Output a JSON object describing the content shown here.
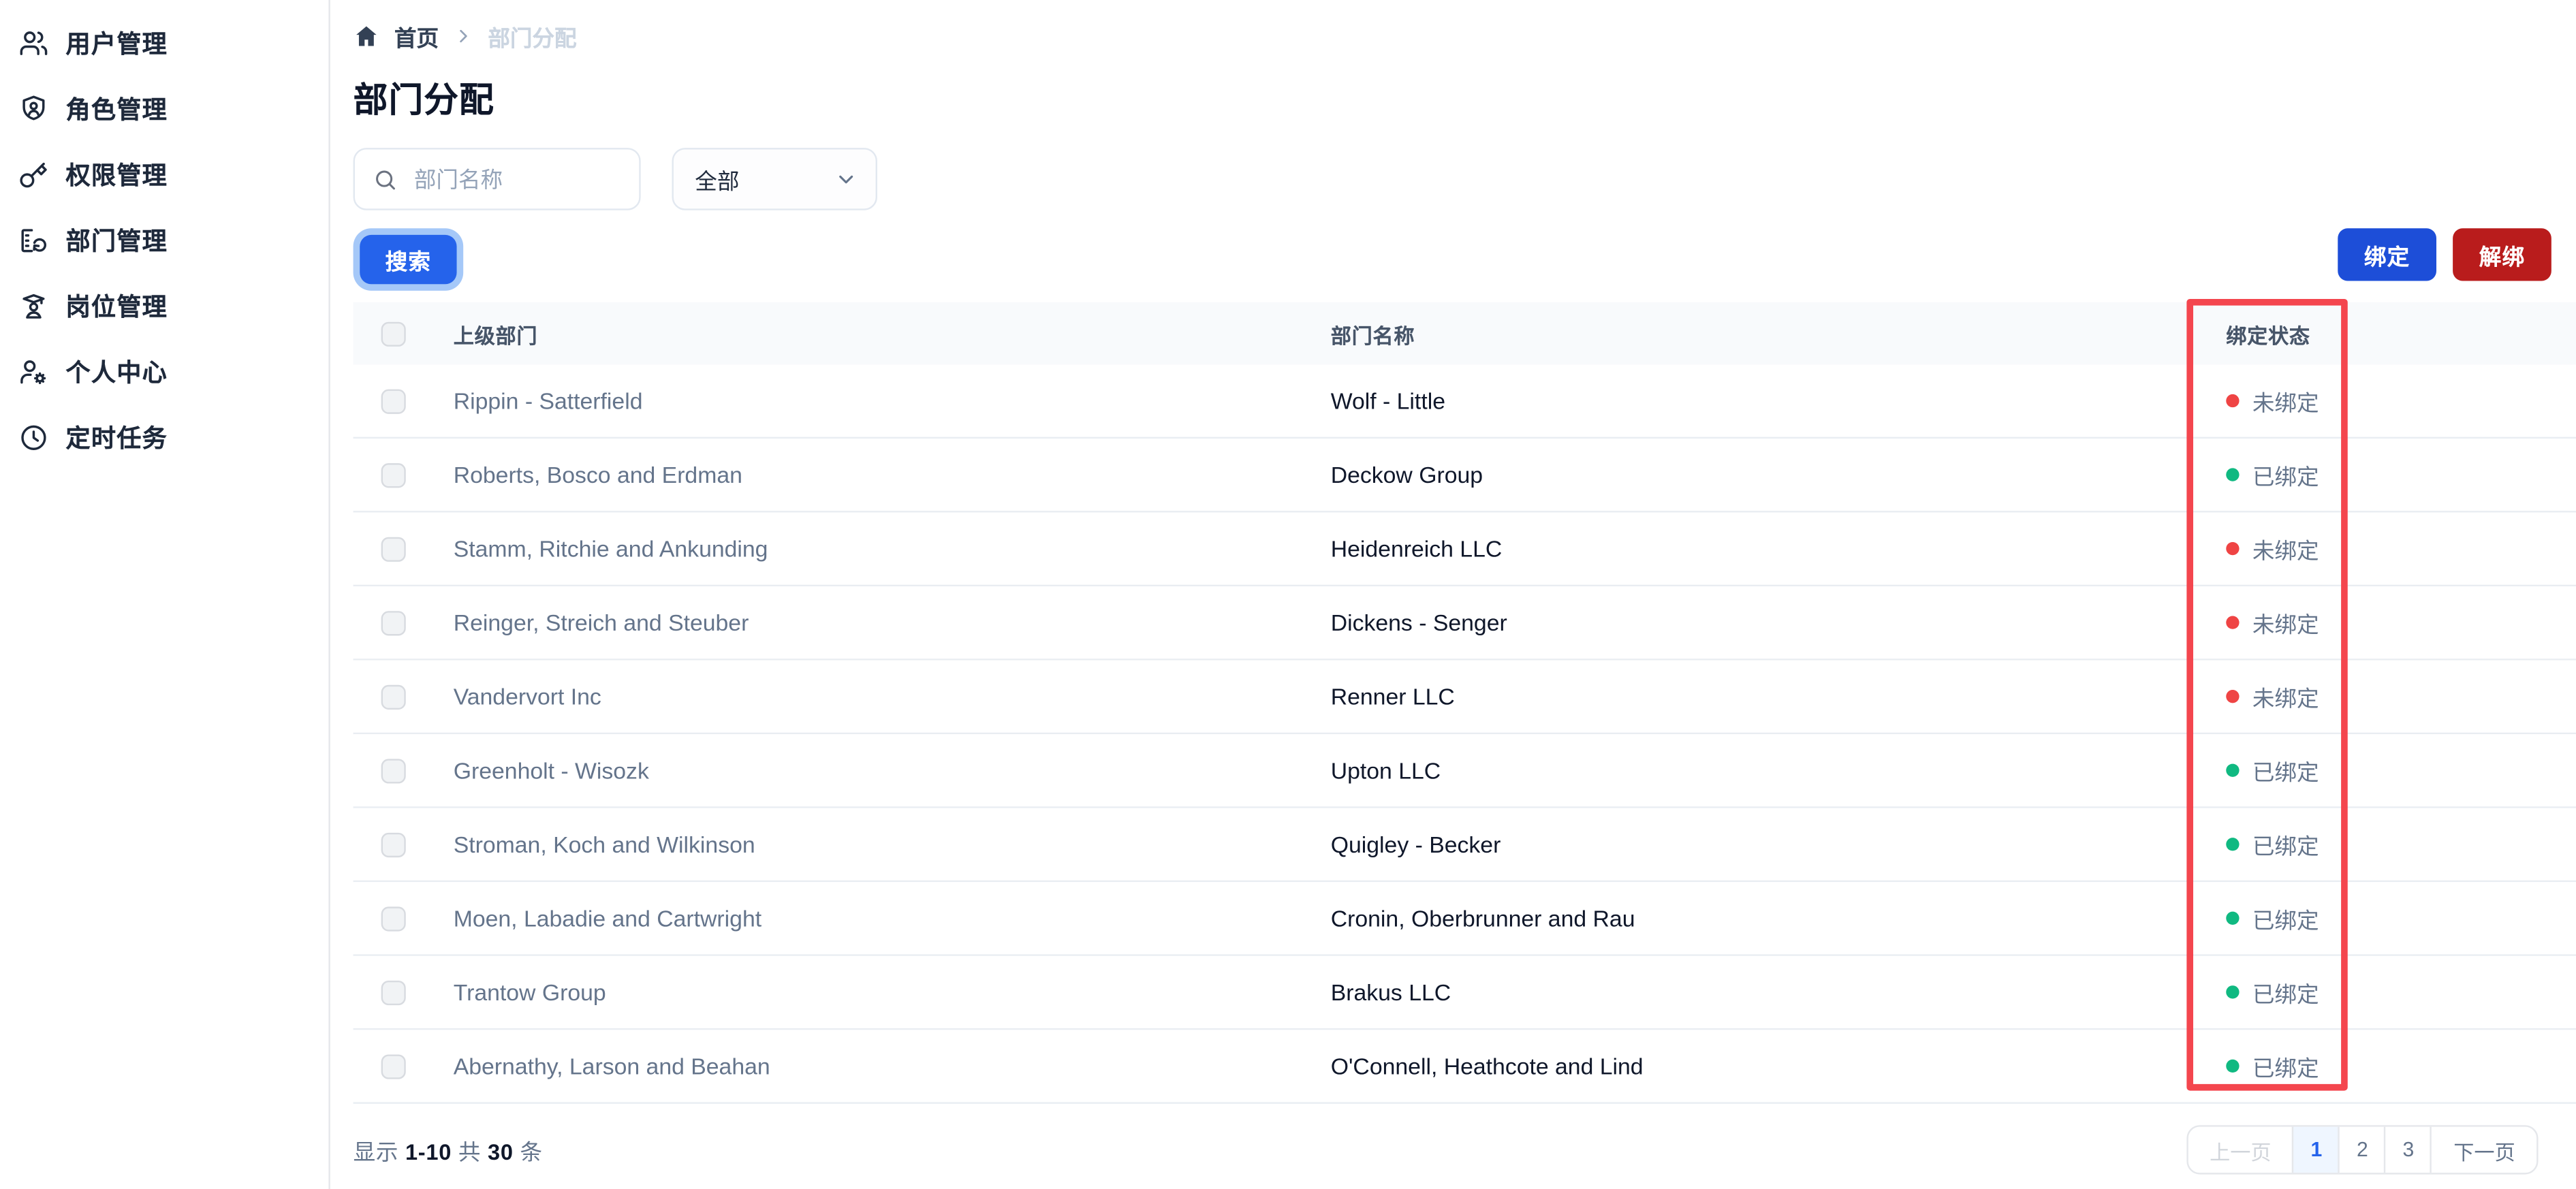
{
  "sidebar": {
    "items": [
      {
        "label": "用户管理",
        "icon": "users-icon"
      },
      {
        "label": "角色管理",
        "icon": "role-shield-icon"
      },
      {
        "label": "权限管理",
        "icon": "key-icon"
      },
      {
        "label": "部门管理",
        "icon": "department-icon"
      },
      {
        "label": "岗位管理",
        "icon": "post-icon"
      },
      {
        "label": "个人中心",
        "icon": "profile-gear-icon"
      },
      {
        "label": "定时任务",
        "icon": "clock-icon"
      }
    ]
  },
  "breadcrumb": {
    "home": "首页",
    "current": "部门分配"
  },
  "page": {
    "title": "部门分配"
  },
  "filters": {
    "search_placeholder": "部门名称",
    "category_value": "全部"
  },
  "actions": {
    "search": "搜索",
    "bind": "绑定",
    "unbind": "解绑"
  },
  "table": {
    "headers": {
      "parent": "上级部门",
      "name": "部门名称",
      "status": "绑定状态"
    },
    "rows": [
      {
        "parent": "Rippin - Satterfield",
        "name": "Wolf - Little",
        "status": "未绑定",
        "bound": false
      },
      {
        "parent": "Roberts, Bosco and Erdman",
        "name": "Deckow Group",
        "status": "已绑定",
        "bound": true
      },
      {
        "parent": "Stamm, Ritchie and Ankunding",
        "name": "Heidenreich LLC",
        "status": "未绑定",
        "bound": false
      },
      {
        "parent": "Reinger, Streich and Steuber",
        "name": "Dickens - Senger",
        "status": "未绑定",
        "bound": false
      },
      {
        "parent": "Vandervort Inc",
        "name": "Renner LLC",
        "status": "未绑定",
        "bound": false
      },
      {
        "parent": "Greenholt - Wisozk",
        "name": "Upton LLC",
        "status": "已绑定",
        "bound": true
      },
      {
        "parent": "Stroman, Koch and Wilkinson",
        "name": "Quigley - Becker",
        "status": "已绑定",
        "bound": true
      },
      {
        "parent": "Moen, Labadie and Cartwright",
        "name": "Cronin, Oberbrunner and Rau",
        "status": "已绑定",
        "bound": true
      },
      {
        "parent": "Trantow Group",
        "name": "Brakus LLC",
        "status": "已绑定",
        "bound": true
      },
      {
        "parent": "Abernathy, Larson and Beahan",
        "name": "O'Connell, Heathcote and Lind",
        "status": "已绑定",
        "bound": true
      }
    ]
  },
  "footer": {
    "summary": {
      "prefix": "显示",
      "range": "1-10",
      "middle": "共",
      "total": "30",
      "suffix": "条"
    },
    "pagination": {
      "prev": "上一页",
      "pages": [
        "1",
        "2",
        "3"
      ],
      "active": "1",
      "next": "下一页"
    }
  },
  "colors": {
    "accent_blue": "#2563eb",
    "bind_blue": "#1d4ed8",
    "unbind_red": "#b91c1c",
    "status_unbound_dot": "#ef4444",
    "status_bound_dot": "#10b981",
    "annotation_red": "#f4464e"
  }
}
